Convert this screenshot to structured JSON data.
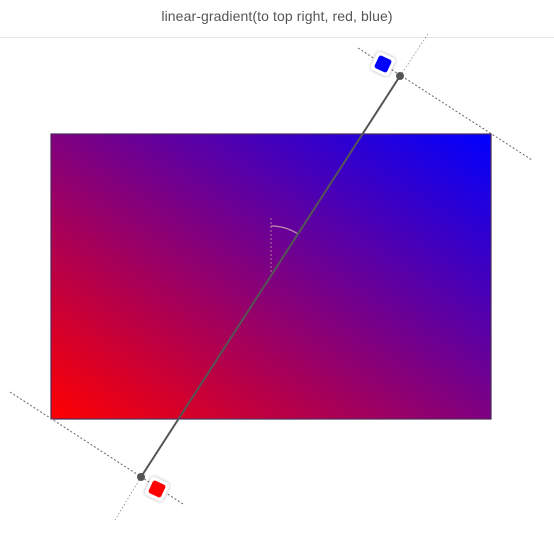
{
  "header": {
    "title": "linear-gradient(to top right, red, blue)"
  },
  "gradient": {
    "direction": "to top right",
    "start_color": "#ff0000",
    "end_color": "#0000ff",
    "box_border_color": "#4a2a5a",
    "axis_line_color": "#555555"
  },
  "handles": {
    "start": {
      "name": "red",
      "color": "#ff0000"
    },
    "end": {
      "name": "blue",
      "color": "#0000ff"
    }
  }
}
